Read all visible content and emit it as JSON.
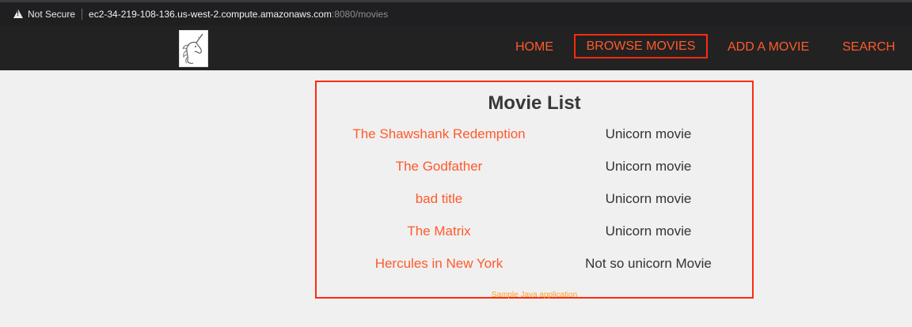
{
  "browser": {
    "security_label": "Not Secure",
    "url_host": "ec2-34-219-108-136.us-west-2.compute.amazonaws.com",
    "url_path": ":8080/movies"
  },
  "nav": {
    "home": "HOME",
    "browse": "BROWSE MOVIES",
    "add": "ADD A MOVIE",
    "search": "SEARCH"
  },
  "page": {
    "title": "Movie List",
    "footer": "Sample Java application"
  },
  "movies": [
    {
      "title": "The Shawshank Redemption",
      "description": "Unicorn movie"
    },
    {
      "title": "The Godfather",
      "description": "Unicorn movie"
    },
    {
      "title": "bad title",
      "description": "Unicorn movie"
    },
    {
      "title": "The Matrix",
      "description": "Unicorn movie"
    },
    {
      "title": "Hercules in New York",
      "description": "Not so unicorn Movie"
    }
  ],
  "colors": {
    "accent": "#ff5a2c",
    "highlight_border": "#ff2a10",
    "navbar": "#222222",
    "background": "#f0f0f0"
  },
  "icons": {
    "security": "warning-triangle-icon",
    "logo": "unicorn-logo"
  }
}
